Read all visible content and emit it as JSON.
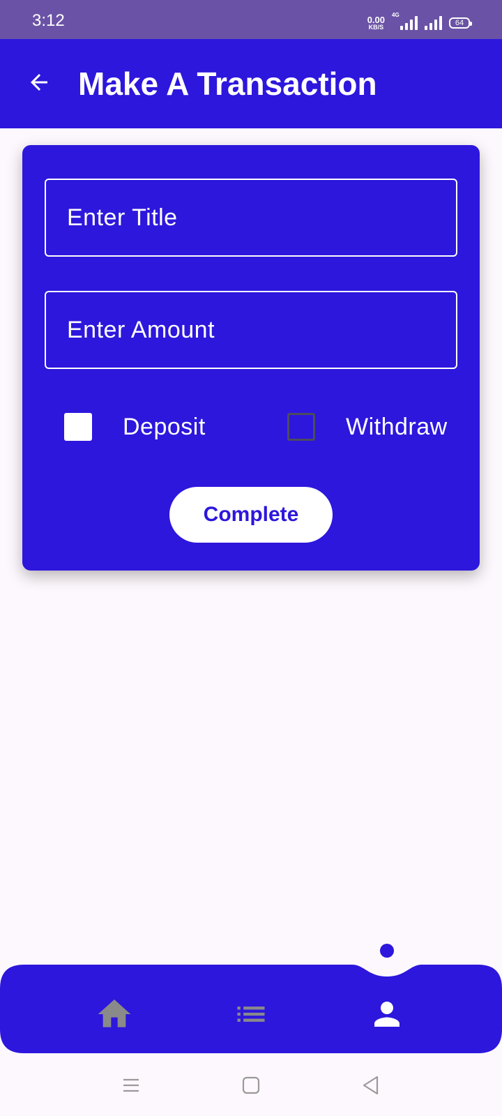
{
  "status_bar": {
    "time": "3:12",
    "net_speed_value": "0.00",
    "net_speed_unit": "KB/S",
    "network_type": "4G",
    "battery_level": "64"
  },
  "app_bar": {
    "title": "Make A Transaction",
    "back_icon": "arrow-left-icon"
  },
  "form": {
    "title_field": {
      "placeholder": "Enter Title",
      "value": ""
    },
    "amount_field": {
      "placeholder": "Enter Amount",
      "value": ""
    },
    "options": [
      {
        "label": "Deposit",
        "checked": true
      },
      {
        "label": "Withdraw",
        "checked": false
      }
    ],
    "submit_label": "Complete"
  },
  "bottom_nav": {
    "items": [
      {
        "icon": "home-icon",
        "active": false
      },
      {
        "icon": "list-icon",
        "active": false
      },
      {
        "icon": "person-icon",
        "active": true
      }
    ]
  },
  "system_nav": {
    "items": [
      "menu-icon",
      "square-home-icon",
      "triangle-back-icon"
    ]
  },
  "colors": {
    "primary": "#2d17dc",
    "status_bar": "#6a53a6",
    "background": "#fdf8fd",
    "inactive_icon": "#8a8a8a",
    "on_primary": "#ffffff"
  }
}
